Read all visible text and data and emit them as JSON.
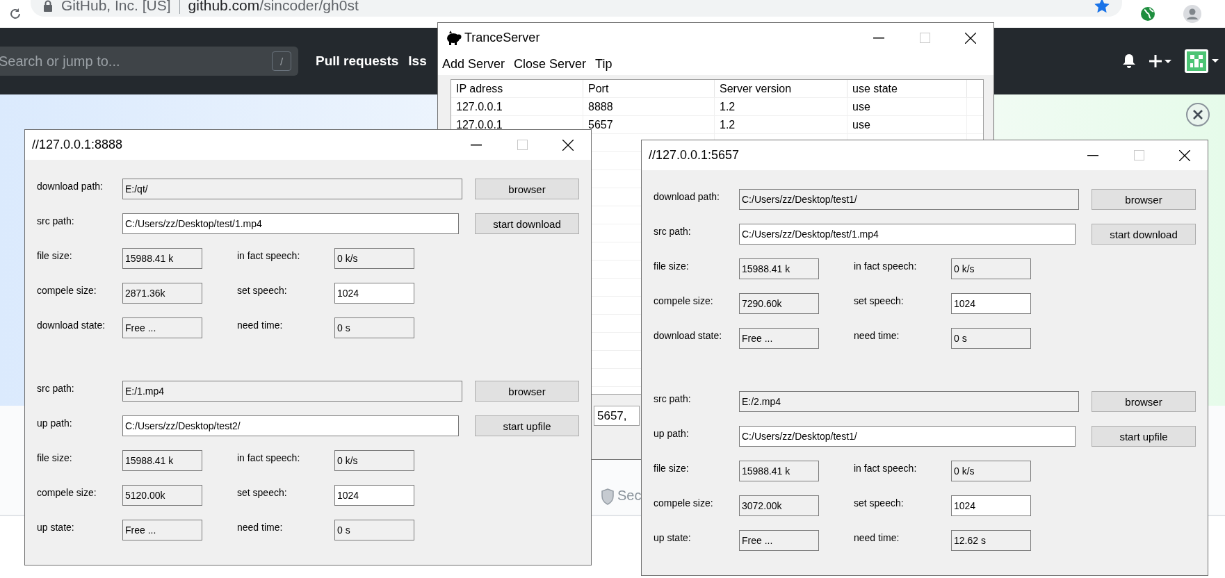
{
  "browser": {
    "site_identity": "GitHub, Inc. [US]",
    "url_domain": "github.com",
    "url_path": "/sincoder/gh0st"
  },
  "github": {
    "search": {
      "placeholder": "Search or jump to...",
      "shortcut": "/"
    },
    "nav": [
      "Pull requests",
      "Iss"
    ],
    "footer_text": "Sec"
  },
  "trance_server": {
    "title": "TranceServer",
    "menu": [
      "Add Server",
      "Close Server",
      "Tip"
    ],
    "table": {
      "columns": [
        "IP adress",
        "Port",
        "Server version",
        "use state"
      ],
      "rows": [
        [
          "127.0.0.1",
          "8888",
          "1.2",
          "use"
        ],
        [
          "127.0.0.1",
          "5657",
          "1.2",
          "use"
        ]
      ]
    },
    "status_field": "5657,"
  },
  "client_windows": [
    {
      "title": "//127.0.0.1:8888",
      "sections": [
        {
          "paths": [
            {
              "label": "download path:",
              "value": "E:/qt/",
              "editable": false,
              "button": "browser"
            },
            {
              "label": "src path:",
              "value": "C:/Users/zz/Desktop/test/1.mp4",
              "editable": true,
              "button": "start download"
            }
          ],
          "stats": [
            {
              "label": "file size:",
              "value": "15988.41 k",
              "editable": false
            },
            {
              "label": "in fact speech:",
              "value": "0 k/s",
              "editable": false
            },
            {
              "label": "compele size:",
              "value": "2871.36k",
              "editable": false
            },
            {
              "label": "set speech:",
              "value": "1024",
              "editable": true
            },
            {
              "label": "download state:",
              "value": "Free ...",
              "editable": false
            },
            {
              "label": "need time:",
              "value": "0 s",
              "editable": false
            }
          ]
        },
        {
          "paths": [
            {
              "label": "src path:",
              "value": "E:/1.mp4",
              "editable": false,
              "button": "browser"
            },
            {
              "label": "up path:",
              "value": "C:/Users/zz/Desktop/test2/",
              "editable": true,
              "button": "start upfile"
            }
          ],
          "stats": [
            {
              "label": "file size:",
              "value": "15988.41 k",
              "editable": false
            },
            {
              "label": "in fact speech:",
              "value": "0 k/s",
              "editable": false
            },
            {
              "label": "compele size:",
              "value": "5120.00k",
              "editable": false
            },
            {
              "label": "set speech:",
              "value": "1024",
              "editable": true
            },
            {
              "label": "up state:",
              "value": "Free ...",
              "editable": false
            },
            {
              "label": "need time:",
              "value": "0 s",
              "editable": false
            }
          ]
        }
      ]
    },
    {
      "title": "//127.0.0.1:5657",
      "sections": [
        {
          "paths": [
            {
              "label": "download path:",
              "value": "C:/Users/zz/Desktop/test1/",
              "editable": false,
              "button": "browser"
            },
            {
              "label": "src path:",
              "value": "C:/Users/zz/Desktop/test/1.mp4",
              "editable": true,
              "button": "start download"
            }
          ],
          "stats": [
            {
              "label": "file size:",
              "value": "15988.41 k",
              "editable": false
            },
            {
              "label": "in fact speech:",
              "value": "0 k/s",
              "editable": false
            },
            {
              "label": "compele size:",
              "value": "7290.60k",
              "editable": false
            },
            {
              "label": "set speech:",
              "value": "1024",
              "editable": true
            },
            {
              "label": "download state:",
              "value": "Free ...",
              "editable": false
            },
            {
              "label": "need time:",
              "value": "0 s",
              "editable": false
            }
          ]
        },
        {
          "paths": [
            {
              "label": "src path:",
              "value": "E:/2.mp4",
              "editable": false,
              "button": "browser"
            },
            {
              "label": "up path:",
              "value": "C:/Users/zz/Desktop/test1/",
              "editable": true,
              "button": "start upfile"
            }
          ],
          "stats": [
            {
              "label": "file size:",
              "value": "15988.41 k",
              "editable": false
            },
            {
              "label": "in fact speech:",
              "value": "0 k/s",
              "editable": false
            },
            {
              "label": "compele size:",
              "value": "3072.00k",
              "editable": false
            },
            {
              "label": "set speech:",
              "value": "1024",
              "editable": true
            },
            {
              "label": "up state:",
              "value": "Free ...",
              "editable": false
            },
            {
              "label": "need time:",
              "value": "12.62 s",
              "editable": false
            }
          ]
        }
      ]
    }
  ]
}
